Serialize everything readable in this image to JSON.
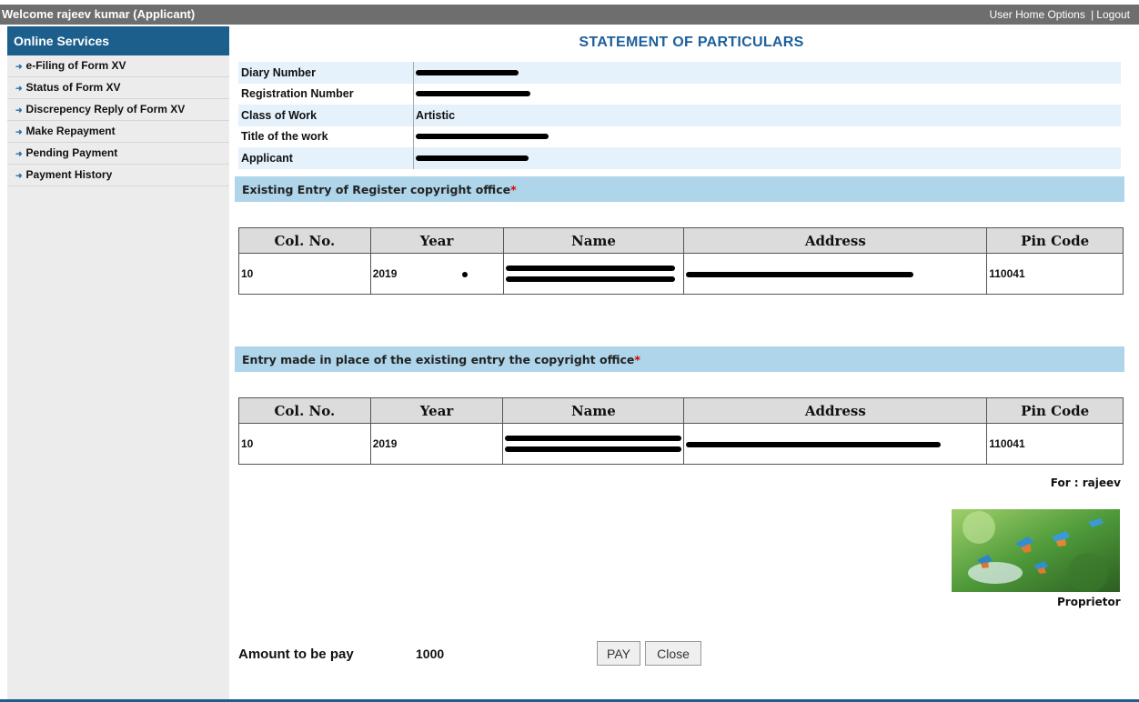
{
  "topbar": {
    "welcome": "Welcome rajeev kumar (Applicant)",
    "user_home": "User Home",
    "options": "Options",
    "separator": "|",
    "logout": "Logout"
  },
  "sidebar": {
    "header": "Online Services",
    "items": [
      {
        "label": "e-Filing of Form XV"
      },
      {
        "label": "Status of Form XV"
      },
      {
        "label": "Discrepency Reply of Form XV"
      },
      {
        "label": "Make Repayment"
      },
      {
        "label": "Pending Payment"
      },
      {
        "label": "Payment History"
      }
    ]
  },
  "page_title": "STATEMENT OF PARTICULARS",
  "particulars": {
    "diary_number_label": "Diary Number",
    "registration_number_label": "Registration Number",
    "class_of_work_label": "Class of Work",
    "class_of_work_value": "Artistic",
    "title_label": "Title of the work",
    "applicant_label": "Applicant"
  },
  "existing_section": {
    "heading": "Existing Entry of Register copyright office",
    "star": "*",
    "columns": [
      "Col. No.",
      "Year",
      "Name",
      "Address",
      "Pin Code"
    ],
    "row": {
      "col_no": "10",
      "year": "2019",
      "pin_code": "110041"
    }
  },
  "replacement_section": {
    "heading": "Entry made in place of the existing entry the copyright office",
    "star": "*",
    "columns": [
      "Col. No.",
      "Year",
      "Name",
      "Address",
      "Pin Code"
    ],
    "row": {
      "col_no": "10",
      "year": "2019",
      "pin_code": "110041"
    }
  },
  "signature": {
    "for_label": "For : rajeev",
    "role": "Proprietor"
  },
  "payment": {
    "amount_label": "Amount to be pay",
    "amount_value": "1000",
    "pay_label": "PAY",
    "close_label": "Close"
  },
  "colors": {
    "topbar": "#6e6e6e",
    "sidebar_header": "#1c5f8c",
    "title": "#1d5f9b",
    "section_band": "#aed5ea",
    "row_band": "#e5f1fb"
  }
}
